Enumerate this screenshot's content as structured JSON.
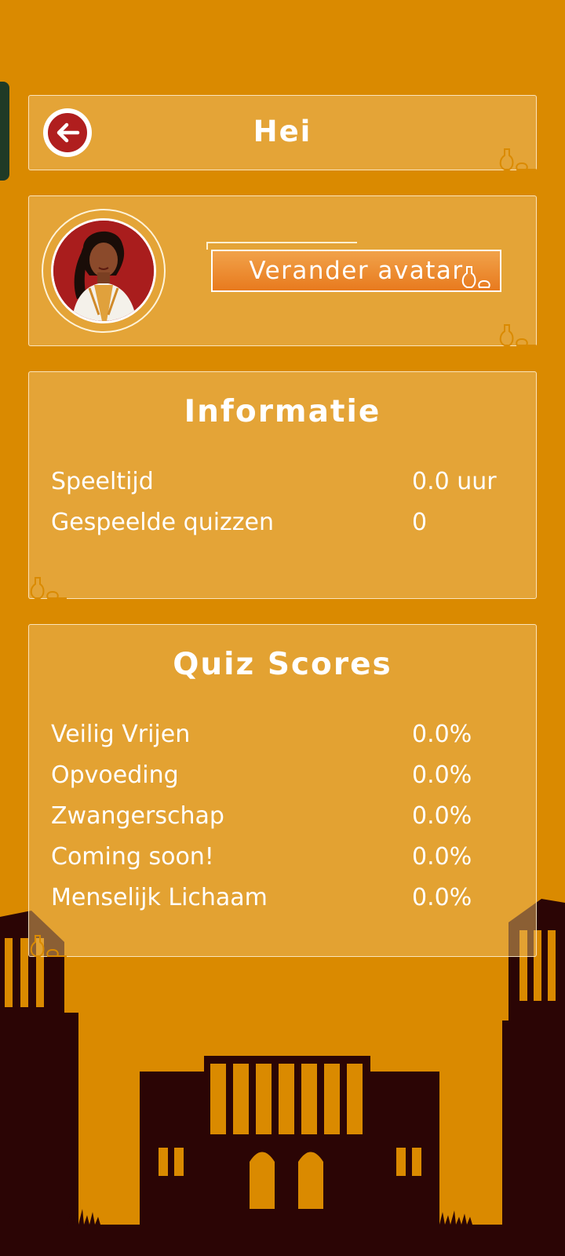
{
  "colors": {
    "background": "#DA8A00",
    "silhouette": "#2B0505",
    "back_button": "#B01E1E"
  },
  "header": {
    "title": "Hei",
    "back_icon": "arrow-left-icon"
  },
  "avatar": {
    "change_button_label": "Verander avatar"
  },
  "information": {
    "title": "Informatie",
    "rows": [
      {
        "label": "Speeltijd",
        "value": "0.0 uur"
      },
      {
        "label": "Gespeelde quizzen",
        "value": "0"
      }
    ]
  },
  "quiz_scores": {
    "title": "Quiz Scores",
    "rows": [
      {
        "label": "Veilig Vrijen",
        "value": "0.0%"
      },
      {
        "label": "Opvoeding",
        "value": "0.0%"
      },
      {
        "label": "Zwangerschap",
        "value": "0.0%"
      },
      {
        "label": "Coming soon!",
        "value": "0.0%"
      },
      {
        "label": "Menselijk Lichaam",
        "value": "0.0%"
      }
    ]
  }
}
